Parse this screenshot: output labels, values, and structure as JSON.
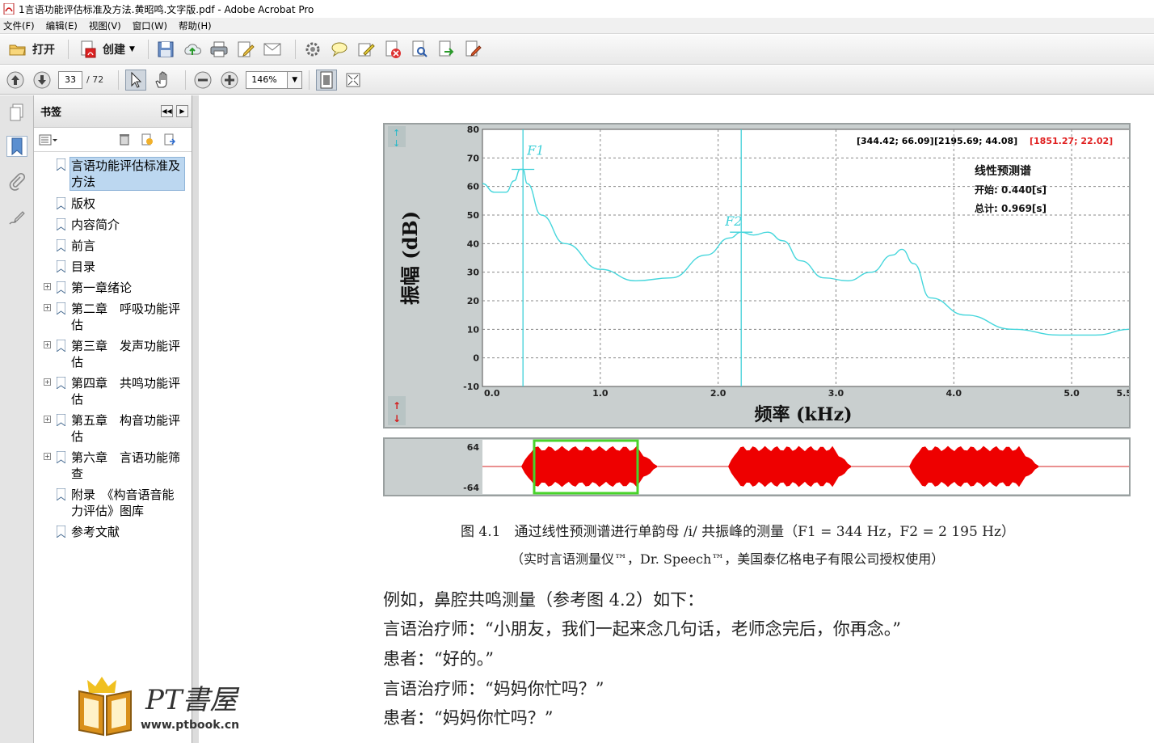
{
  "window": {
    "title": "1言语功能评估标准及方法.黄昭鸣.文字版.pdf - Adobe Acrobat Pro"
  },
  "menu": [
    "文件(F)",
    "编辑(E)",
    "视图(V)",
    "窗口(W)",
    "帮助(H)"
  ],
  "toolbar": {
    "open_label": "打开",
    "create_label": "创建"
  },
  "nav": {
    "page_current": "33",
    "page_total": "/ 72",
    "zoom": "146%"
  },
  "bookmarks": {
    "title": "书签",
    "items": [
      {
        "label": "言语功能评估标准及方法",
        "expandable": false,
        "selected": true
      },
      {
        "label": "版权",
        "expandable": false
      },
      {
        "label": "内容简介",
        "expandable": false
      },
      {
        "label": "前言",
        "expandable": false
      },
      {
        "label": "目录",
        "expandable": false
      },
      {
        "label": "第一章绪论",
        "expandable": true
      },
      {
        "label": "第二章　呼吸功能评估",
        "expandable": true
      },
      {
        "label": "第三章　发声功能评估",
        "expandable": true
      },
      {
        "label": "第四章　共鸣功能评估",
        "expandable": true
      },
      {
        "label": "第五章　构音功能评估",
        "expandable": true
      },
      {
        "label": "第六章　言语功能筛查",
        "expandable": true
      },
      {
        "label": "附录　《构音语音能力评估》图库",
        "expandable": false
      },
      {
        "label": "参考文献",
        "expandable": false
      }
    ]
  },
  "chart_data": {
    "type": "line",
    "title": "",
    "xlabel": "频率 (kHz)",
    "ylabel": "振幅 (dB)",
    "xlim": [
      0,
      5.5
    ],
    "ylim": [
      -10,
      80
    ],
    "x_ticks": [
      "0.0",
      "1.0",
      "2.0",
      "3.0",
      "4.0",
      "5.0",
      "5.5"
    ],
    "y_ticks": [
      "80",
      "70",
      "60",
      "50",
      "40",
      "30",
      "20",
      "10",
      "0",
      "-10"
    ],
    "grid": true,
    "readouts": [
      "[344.42; 66.09]",
      "[2195.69; 44.08]",
      "[1851.27; 22.02]"
    ],
    "readout_colors": [
      "#000000",
      "#000000",
      "#e02020"
    ],
    "legend_lines": [
      "线性预测谱",
      "开始: 0.440[s]",
      "总计: 0.969[s]"
    ],
    "formant_labels": [
      "F1",
      "F2"
    ],
    "formant_markers_khz": [
      0.344,
      2.196
    ],
    "series": [
      {
        "color": "#45d6dc",
        "x": [
          0.0,
          0.1,
          0.2,
          0.27,
          0.32,
          0.344,
          0.38,
          0.5,
          0.7,
          1.0,
          1.3,
          1.6,
          1.9,
          2.1,
          2.196,
          2.3,
          2.42,
          2.55,
          2.7,
          2.9,
          3.1,
          3.3,
          3.48,
          3.56,
          3.66,
          3.8,
          4.1,
          4.5,
          4.9,
          5.2,
          5.5
        ],
        "y": [
          61,
          58,
          58,
          62,
          66,
          66,
          61,
          50,
          40,
          31,
          27,
          28,
          36,
          42,
          44,
          43,
          44,
          41,
          34,
          28,
          27,
          30,
          36,
          38,
          33,
          21,
          15,
          10,
          8,
          8,
          10
        ]
      }
    ],
    "waveform": {
      "ylabels": [
        "64",
        "-64"
      ],
      "segments_fraction": [
        [
          0.06,
          0.27
        ],
        [
          0.38,
          0.57
        ],
        [
          0.66,
          0.86
        ]
      ],
      "selection_fraction": [
        0.08,
        0.24
      ]
    }
  },
  "figure": {
    "caption": "图 4.1　通过线性预测谱进行单韵母 /i/ 共振峰的测量（F1 = 344 Hz，F2 = 2 195 Hz）",
    "credit": "（实时言语测量仪™，Dr. Speech™，美国泰亿格电子有限公司授权使用）"
  },
  "body_lines": [
    "例如，鼻腔共鸣测量（参考图 4.2）如下：",
    "言语治疗师：“小朋友，我们一起来念几句话，老师念完后，你再念。”",
    "患者：“好的。”",
    "言语治疗师：“妈妈你忙吗？”",
    "患者：“妈妈你忙吗？”"
  ],
  "watermark": {
    "text": "PT書屋",
    "url": "www.ptbook.cn"
  }
}
